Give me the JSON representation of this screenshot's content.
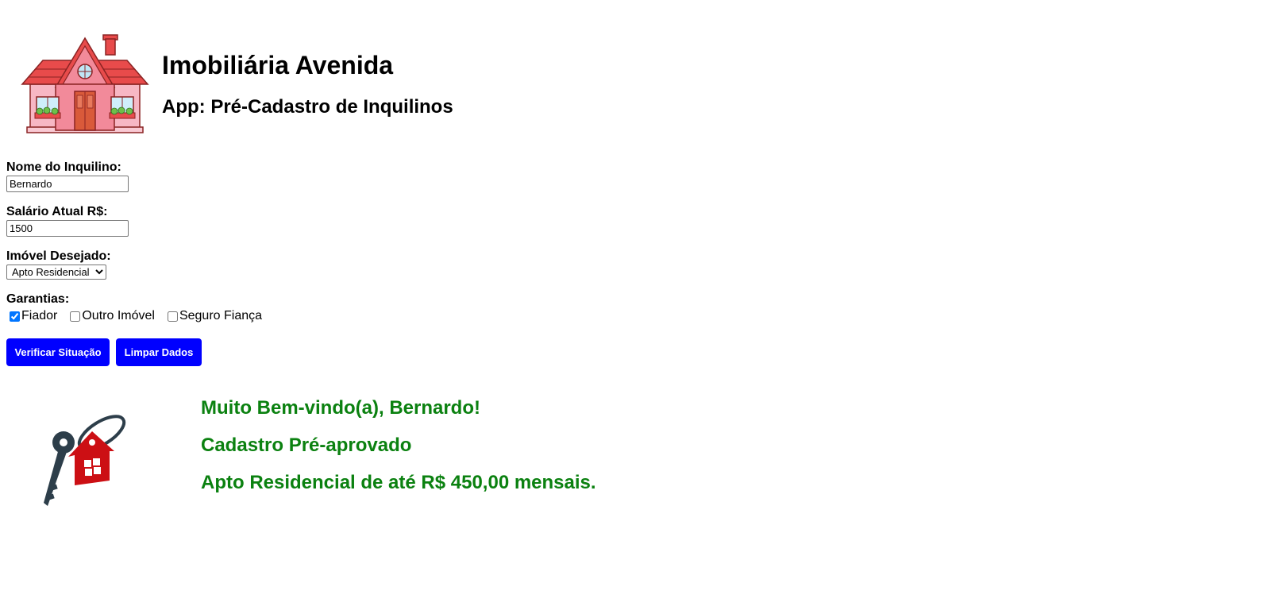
{
  "header": {
    "logo_icon": "house-icon",
    "title": "Imobiliária Avenida",
    "subtitle": "App: Pré-Cadastro de Inquilinos"
  },
  "form": {
    "name_label": "Nome do Inquilino:",
    "name_value": "Bernardo",
    "salary_label": "Salário Atual R$:",
    "salary_value": "1500",
    "property_label": "Imóvel Desejado:",
    "property_selected": "Apto Residencial",
    "guarantees_label": "Garantias:",
    "guarantees": [
      {
        "label": "Fiador",
        "checked": true
      },
      {
        "label": "Outro Imóvel",
        "checked": false
      },
      {
        "label": "Seguro Fiança",
        "checked": false
      }
    ],
    "verify_button": "Verificar Situação",
    "clear_button": "Limpar Dados"
  },
  "result": {
    "image_icon": "house-key-icon",
    "welcome": "Muito Bem-vindo(a), Bernardo!",
    "status": "Cadastro Pré-aprovado",
    "limit": "Apto Residencial de até R$ 450,00 mensais."
  },
  "colors": {
    "button_bg": "#0000ff",
    "button_text": "#ffffff",
    "result_text": "#0b8110",
    "house_roof": "#e84b4b",
    "house_wall": "#f7b7c4"
  }
}
